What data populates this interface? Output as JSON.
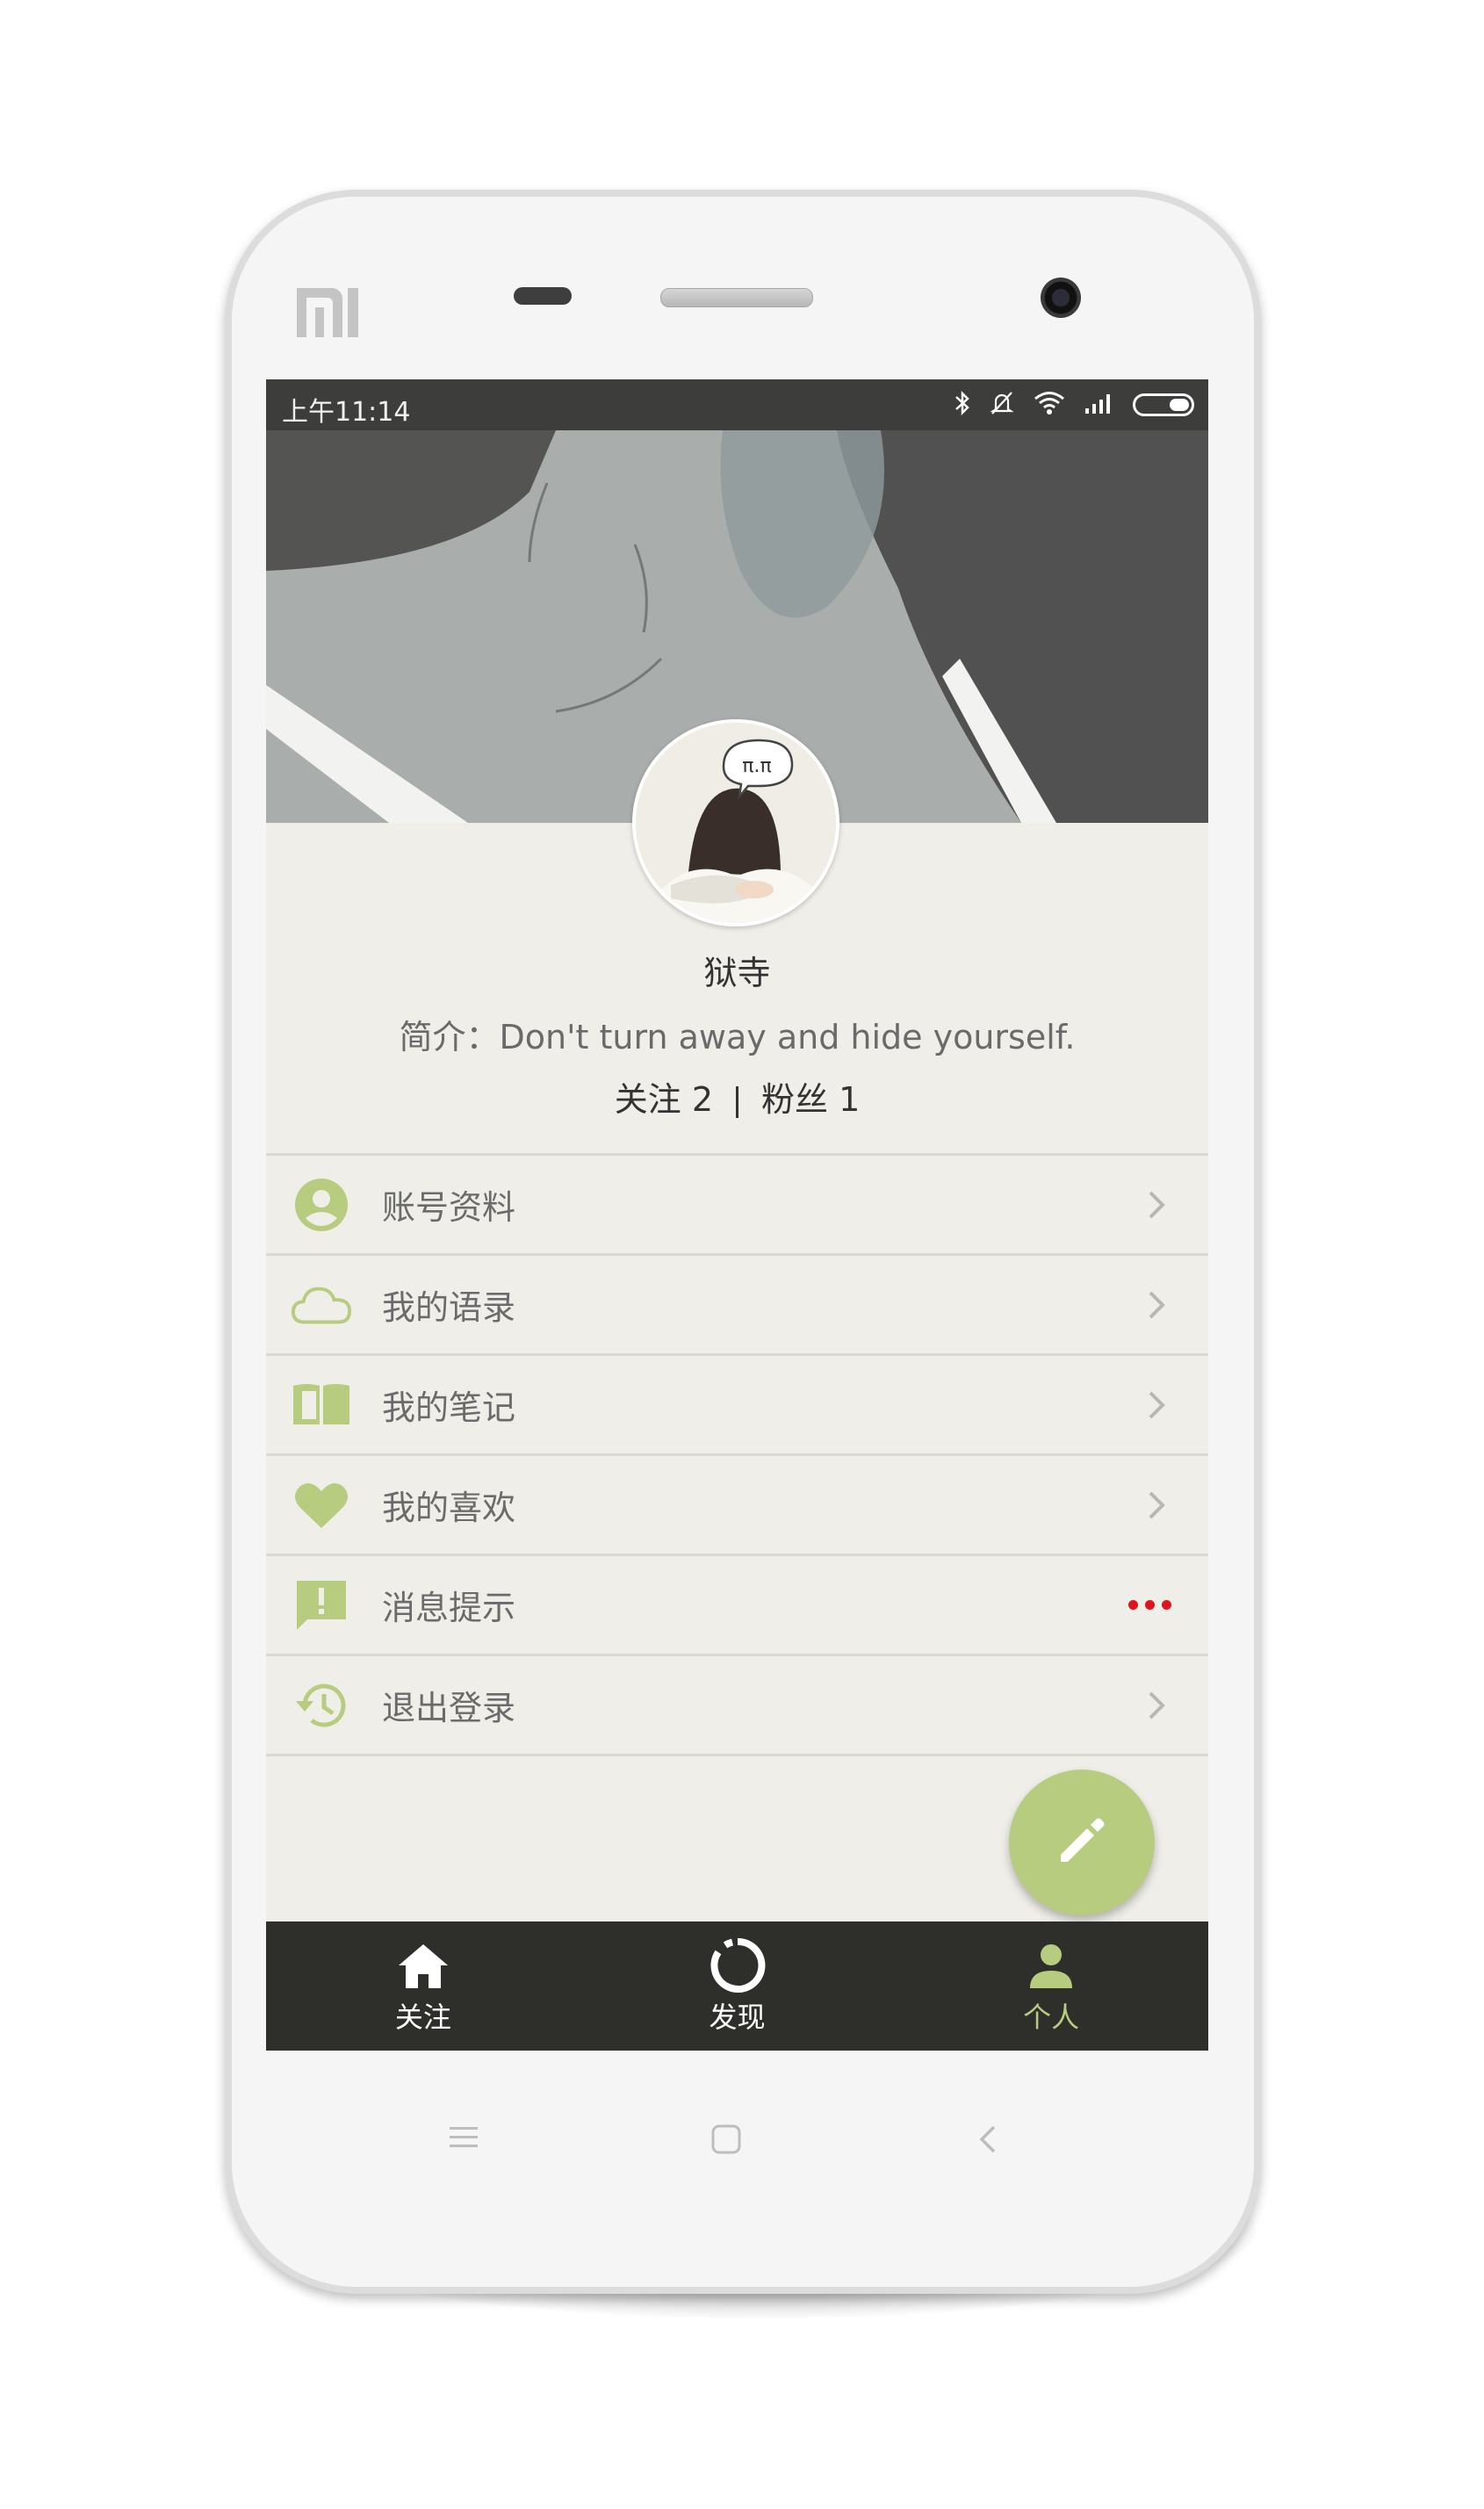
{
  "status_bar": {
    "time": "上午11:14"
  },
  "profile": {
    "name": "狱寺",
    "bio": "简介：Don't turn away and hide yourself.",
    "following_label": "关注 2",
    "followers_label": "粉丝 1"
  },
  "menu": {
    "items": [
      {
        "label": "账号资料",
        "icon": "account-circle-icon"
      },
      {
        "label": "我的语录",
        "icon": "cloud-icon"
      },
      {
        "label": "我的笔记",
        "icon": "book-icon"
      },
      {
        "label": "我的喜欢",
        "icon": "heart-icon"
      },
      {
        "label": "消息提示",
        "icon": "message-alert-icon"
      },
      {
        "label": "退出登录",
        "icon": "history-icon"
      }
    ]
  },
  "bottom_nav": {
    "tabs": [
      {
        "label": "关注",
        "icon": "home-icon",
        "active": false
      },
      {
        "label": "发现",
        "icon": "discover-ring-icon",
        "active": false
      },
      {
        "label": "个人",
        "icon": "person-icon",
        "active": true
      }
    ]
  },
  "colors": {
    "accent": "#b7cc7e",
    "screen_bg": "#efeee8",
    "bar_bg": "#2e2e2b",
    "badge_red": "#e0141b"
  }
}
